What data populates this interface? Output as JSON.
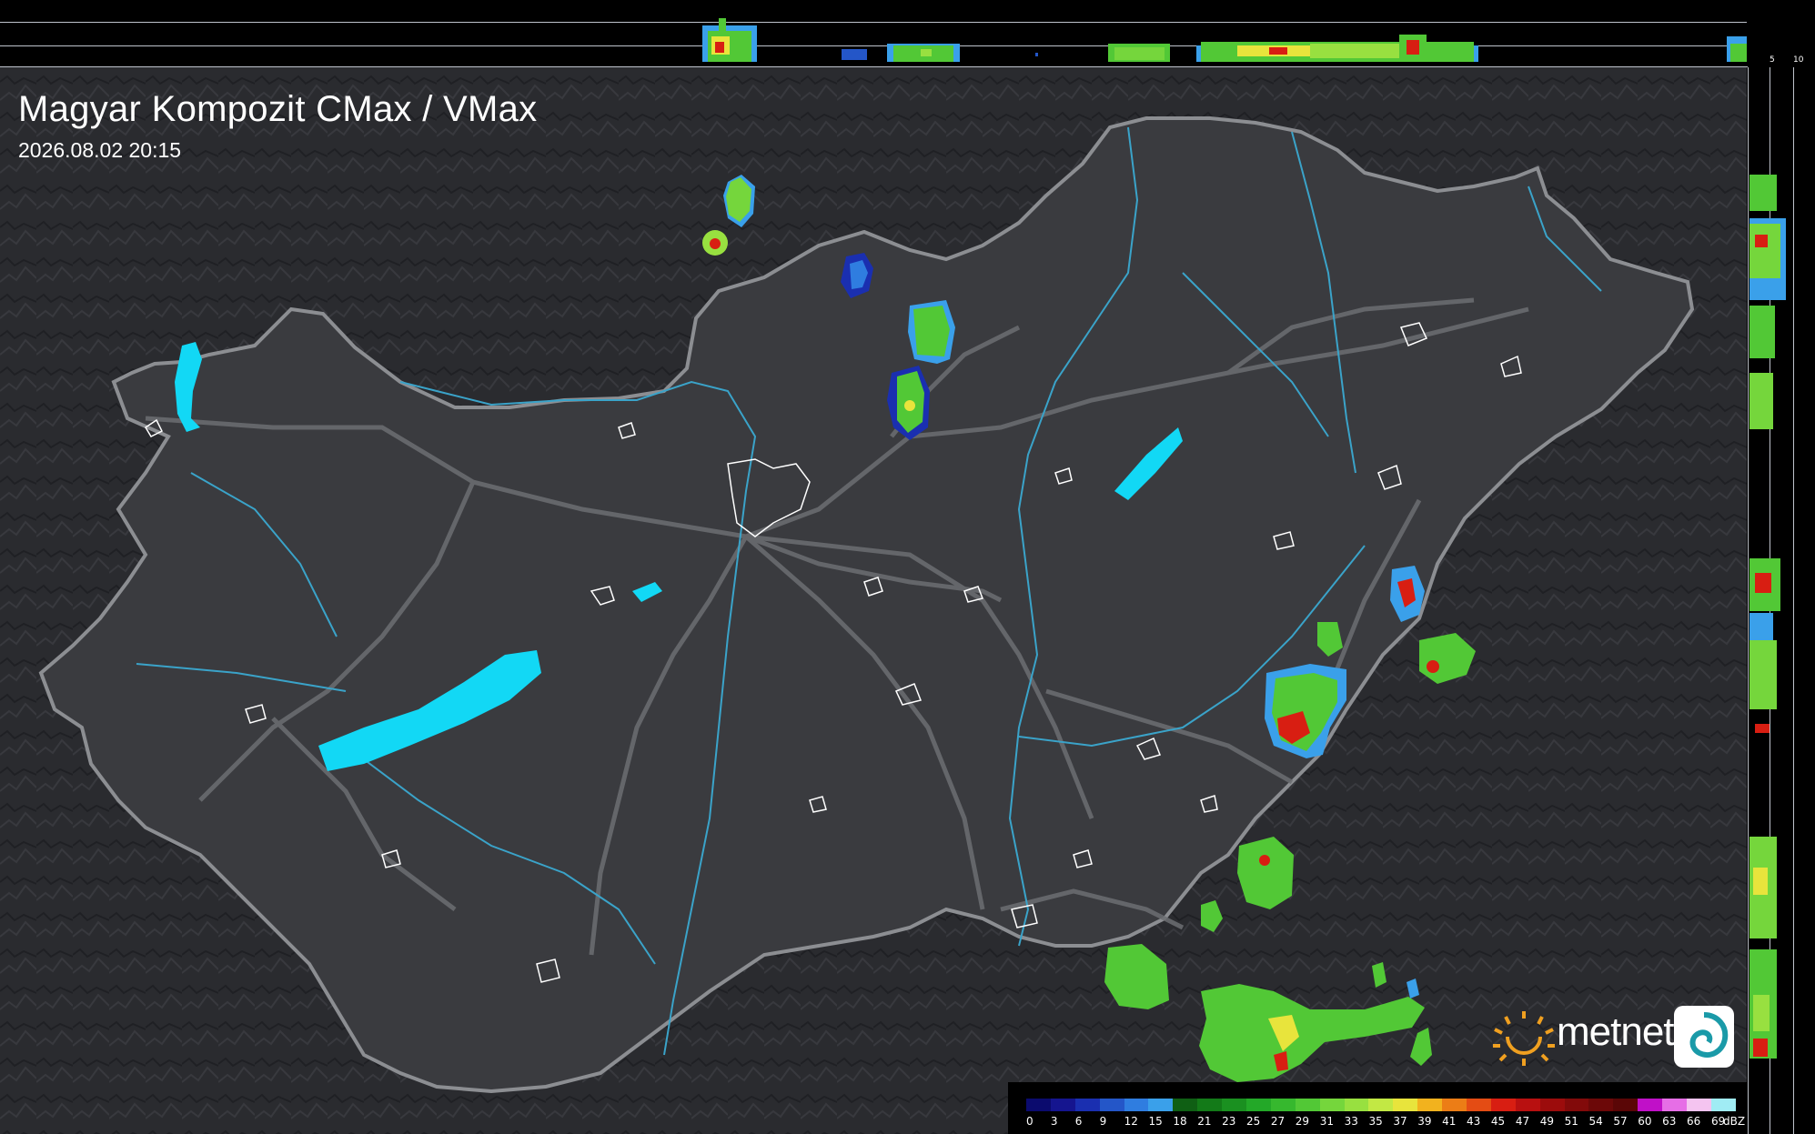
{
  "header": {
    "title": "Magyar Kompozit CMax / VMax",
    "timestamp": "2026.08.02 20:15"
  },
  "profile_scale": {
    "top_labels": [
      "10",
      "5"
    ],
    "right_labels": [
      "5",
      "10"
    ]
  },
  "legend": {
    "unit": "dBZ",
    "values": [
      "0",
      "3",
      "6",
      "9",
      "12",
      "15",
      "18",
      "21",
      "23",
      "25",
      "27",
      "29",
      "31",
      "33",
      "35",
      "37",
      "39",
      "41",
      "43",
      "45",
      "47",
      "49",
      "51",
      "54",
      "57",
      "60",
      "63",
      "66",
      "69"
    ],
    "colors": [
      "#0b0b6e",
      "#15158f",
      "#1a2fb0",
      "#2456c8",
      "#2f7de0",
      "#3aa0ea",
      "#0f5f14",
      "#137a18",
      "#1a9020",
      "#23a828",
      "#36b82e",
      "#52c836",
      "#75d63c",
      "#98e040",
      "#c2e844",
      "#e8e43c",
      "#f2b21e",
      "#ec7d16",
      "#e44c14",
      "#d81e12",
      "#b81010",
      "#9c0c0c",
      "#820a0a",
      "#6c0808",
      "#5a0606",
      "#c010c8",
      "#e66ee6",
      "#f4c4f0",
      "#a0ecf4"
    ]
  },
  "logo": {
    "brand": "metnet"
  }
}
